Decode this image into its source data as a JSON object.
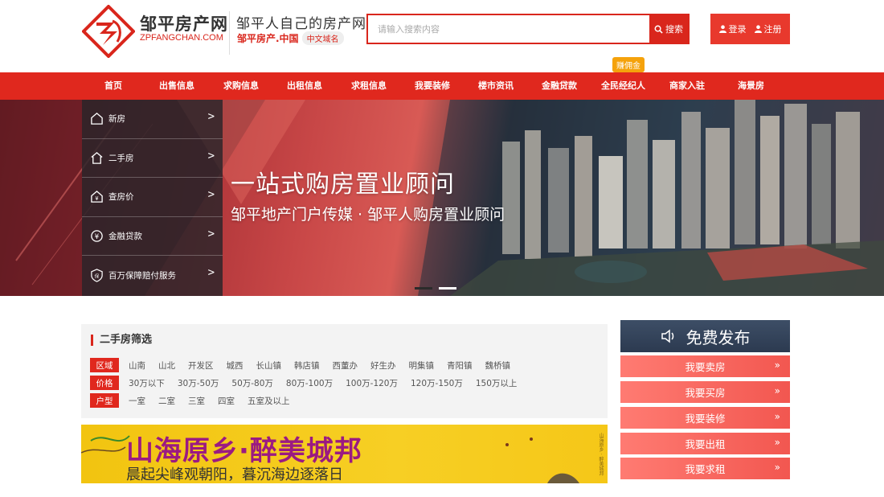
{
  "header": {
    "logo_name": "邹平房产网",
    "logo_sub": "ZPFANGCHAN.COM",
    "slogan": "邹平人自己的房产网",
    "domain": "邹平房产.中国",
    "domain_badge": "中文域名",
    "search_placeholder": "请输入搜索内容",
    "search_label": "搜索",
    "login_label": "登录",
    "register_label": "注册",
    "tag_yongjin": "赚佣金"
  },
  "nav": [
    {
      "label": "首页"
    },
    {
      "label": "出售信息"
    },
    {
      "label": "求购信息"
    },
    {
      "label": "出租信息"
    },
    {
      "label": "求租信息"
    },
    {
      "label": "我要装修"
    },
    {
      "label": "楼市资讯"
    },
    {
      "label": "金融贷款"
    },
    {
      "label": "全民经纪人"
    },
    {
      "label": "商家入驻"
    },
    {
      "label": "海景房"
    }
  ],
  "side_menu": [
    {
      "label": "新房",
      "icon": "house-icon"
    },
    {
      "label": "二手房",
      "icon": "house-outline-icon"
    },
    {
      "label": "查房价",
      "icon": "price-house-icon"
    },
    {
      "label": "金融贷款",
      "icon": "yuan-coin-icon"
    },
    {
      "label": "百万保障赔付服务",
      "icon": "shield-guarantee-icon"
    }
  ],
  "banner": {
    "title": "一站式购房置业顾问",
    "subtitle": "邹平地产门户传媒 · 邹平人购房置业顾问",
    "active_dot": 1,
    "dot_count": 2
  },
  "filter": {
    "title": "二手房筛选",
    "rows": [
      {
        "label": "区域",
        "options": [
          "山南",
          "山北",
          "开发区",
          "城西",
          "长山镇",
          "韩店镇",
          "西董办",
          "好生办",
          "明集镇",
          "青阳镇",
          "魏桥镇"
        ]
      },
      {
        "label": "价格",
        "options": [
          "30万以下",
          "30万-50万",
          "50万-80万",
          "80万-100万",
          "100万-120万",
          "120万-150万",
          "150万以上"
        ]
      },
      {
        "label": "户型",
        "options": [
          "一室",
          "二室",
          "三室",
          "四室",
          "五室及以上"
        ]
      }
    ]
  },
  "ad": {
    "title": "山海原乡·醉美城邦",
    "subtitle": "晨起尖峰观朝阳，暮沉海边逐落日",
    "side_text": "山海原乡 · 醉美城邦"
  },
  "publish": {
    "title": "免费发布",
    "buttons": [
      "我要卖房",
      "我要买房",
      "我要装修",
      "我要出租",
      "我要求租"
    ]
  },
  "colors": {
    "brand_red": "#e0281e",
    "publish_head": "#2c3a50",
    "publish_btn": "#f25750",
    "ad_yellow": "#f7cf24",
    "ad_purple": "#9b1a82"
  }
}
